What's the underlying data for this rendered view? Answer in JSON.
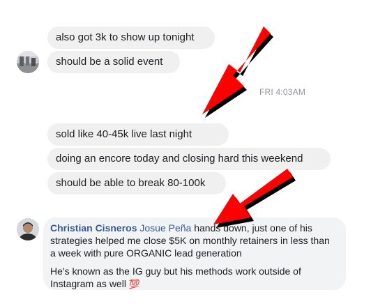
{
  "messages": [
    {
      "text": "also got 3k to show up tonight"
    },
    {
      "text": "should be a solid event"
    },
    {
      "text": "sold like 40-45k live last night"
    },
    {
      "text": "doing an encore today and closing hard this weekend"
    },
    {
      "text": "should be able to break 80-100k"
    }
  ],
  "timestamp": "FRI 4:03AM",
  "comment": {
    "author": "Christian Cisneros",
    "mention": "Josue Peña",
    "line1_rest": " hands down, just one of his strategies helped me close $5K on monthly retainers in less than a week with pure ORGANIC lead generation",
    "line2": "He's known as the IG guy but his methods work outside of Instagram as well ",
    "emoji": "💯"
  },
  "colors": {
    "bubble": "#f1f0f0",
    "comment_bg": "#f2f3f5",
    "name_link": "#385898",
    "arrow_red": "#ff0000",
    "emoji_red": "#e0245e"
  }
}
